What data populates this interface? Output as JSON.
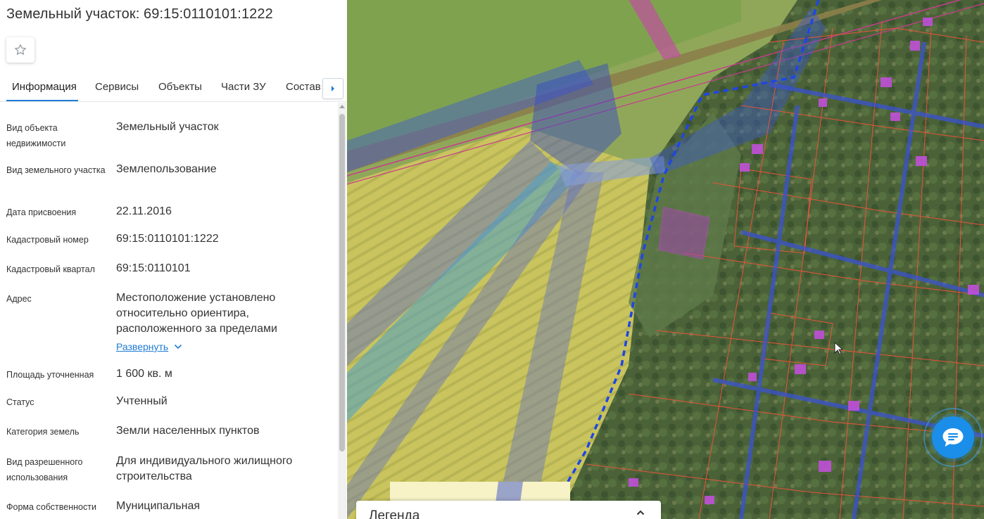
{
  "panel": {
    "title": "Земельный участок: 69:15:0110101:1222",
    "tabs": [
      {
        "label": "Информация",
        "active": true
      },
      {
        "label": "Сервисы"
      },
      {
        "label": "Объекты"
      },
      {
        "label": "Части ЗУ"
      },
      {
        "label": "Состав"
      }
    ],
    "rows": [
      {
        "label": "Вид объекта недвижимости",
        "value": "Земельный участок"
      },
      {
        "label": "Вид земельного участка",
        "value": "Землепользование"
      },
      {
        "label": "Дата присвоения",
        "value": "22.11.2016"
      },
      {
        "label": "Кадастровый номер",
        "value": "69:15:0110101:1222"
      },
      {
        "label": "Кадастровый квартал",
        "value": "69:15:0110101"
      },
      {
        "label": "Адрес",
        "value": "Местоположение установлено относительно ориентира, расположенного за пределами"
      },
      {
        "label": "Площадь уточненная",
        "value": "1 600 кв. м"
      },
      {
        "label": "Статус",
        "value": "Учтенный"
      },
      {
        "label": "Категория земель",
        "value": "Земли населенных пунктов"
      },
      {
        "label": "Вид разрешенного использования",
        "value": "Для индивидуального жилищного строительства"
      },
      {
        "label": "Форма собственности",
        "value": "Муниципальная"
      }
    ],
    "expand_label": "Развернуть"
  },
  "legend": {
    "title": "Легенда"
  },
  "icons": {
    "favorite": "star-outline-icon",
    "tabs_next": "chevron-right-icon",
    "expand": "chevron-down-icon",
    "legend_toggle": "chevron-up-icon",
    "chat": "chat-bubble-icon"
  },
  "colors": {
    "accent": "#1f7bd6",
    "boundary_dashed": "#1e46e6",
    "parcel_outline": "#e8543a",
    "zone_fill": "#4a6cd0",
    "selected_parcel": "#b03cc4"
  }
}
